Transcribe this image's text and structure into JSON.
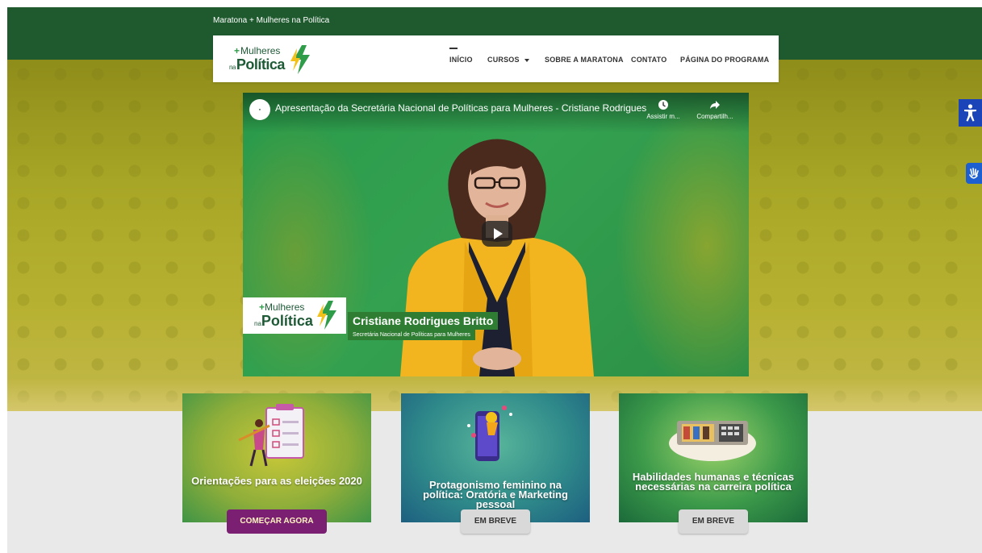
{
  "site": {
    "topbar_title": "Maratona + Mulheres na Política"
  },
  "logo": {
    "line1": "Mulheres",
    "prefix": "na",
    "line2": "Política"
  },
  "nav": {
    "items": [
      {
        "label": "INÍCIO"
      },
      {
        "label": "CURSOS"
      },
      {
        "label": "SOBRE A MARATONA"
      },
      {
        "label": "CONTATO"
      },
      {
        "label": "PÁGINA DO PROGRAMA"
      }
    ]
  },
  "video": {
    "title": "Apresentação da Secretária Nacional de Políticas para Mulheres - Cristiane Rodrigues ...",
    "watch_later": "Assistir m...",
    "share": "Compartilh...",
    "lower_third_name": "Cristiane Rodrigues Britto",
    "lower_third_role": "Secretária Nacional  de Políticas para Mulheres"
  },
  "cards": [
    {
      "title": "Orientações para as eleições 2020",
      "button": "COMEÇAR AGORA"
    },
    {
      "title": "Protagonismo feminino na política: Oratória e Marketing pessoal",
      "button": "EM BREVE"
    },
    {
      "title": "Habilidades humanas e técnicas necessárias na carreira política",
      "button": "EM BREVE"
    }
  ],
  "colors": {
    "topbar": "#1f5a2f",
    "brand_green": "#1e5a36",
    "primary_button": "#7b1f72",
    "accessibility_blue": "#1b44b8"
  },
  "icons": {
    "accessibility": "accessibility-icon",
    "libras": "sign-language-hand-icon",
    "watch_later": "clock-icon",
    "share": "share-arrow-icon",
    "play": "play-icon"
  }
}
